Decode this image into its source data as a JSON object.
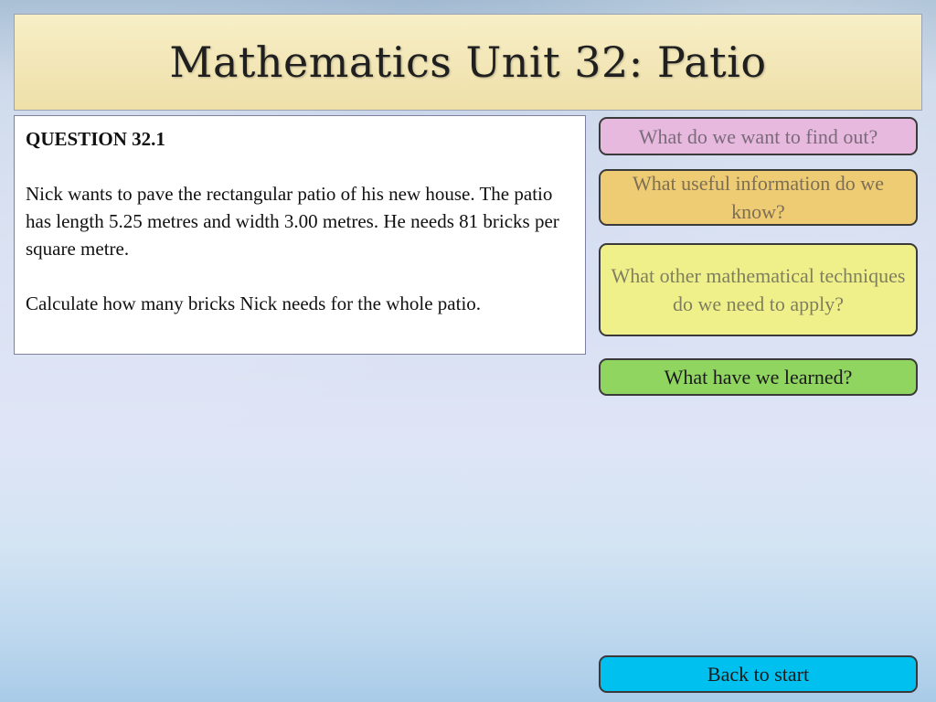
{
  "title": "Mathematics Unit 32: Patio",
  "question": {
    "heading": "QUESTION 32.1",
    "paragraph1": "Nick wants to pave the rectangular patio of his new house.  The patio has length 5.25 metres and width 3.00 metres.  He needs 81 bricks per square metre.",
    "paragraph2": "Calculate how many bricks Nick needs for the whole patio."
  },
  "buttons": {
    "find_out": "What do we want to find out?",
    "useful_info": "What useful information do we know?",
    "techniques": "What other mathematical techniques do we need to apply?",
    "learned": "What have we learned?",
    "back": "Back to start"
  },
  "colors": {
    "find_out": "#e7b9de",
    "useful_info": "#edcc74",
    "techniques": "#f0f08a",
    "learned": "#90d560",
    "back": "#00c0f0",
    "title_bar": "#f3e7b8"
  }
}
